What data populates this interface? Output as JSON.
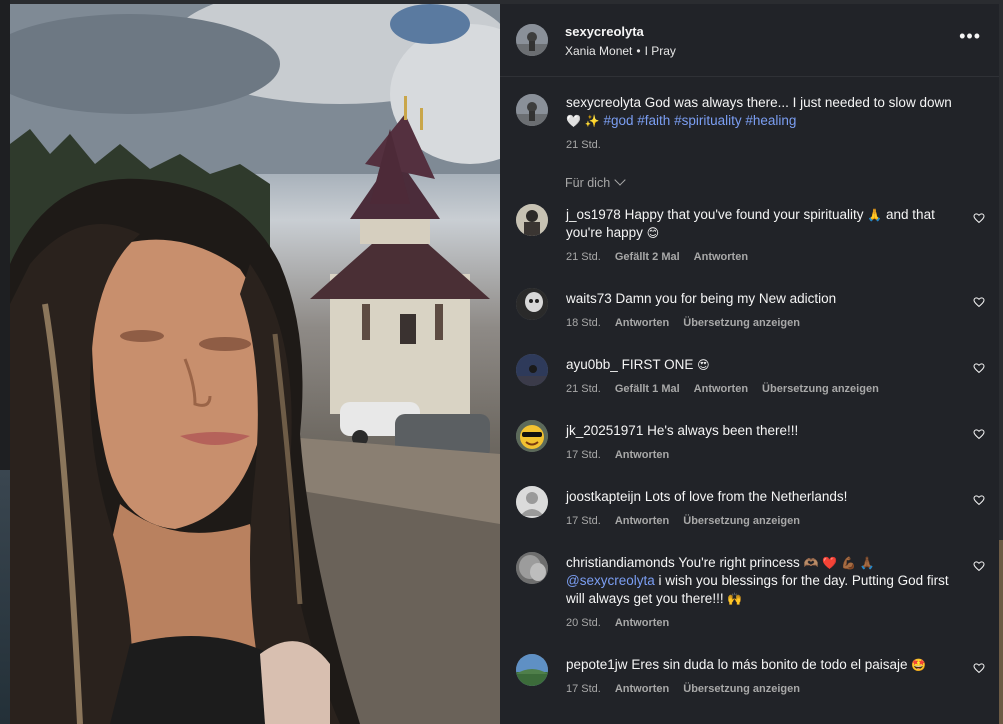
{
  "post": {
    "username": "sexycreolyta",
    "music_artist": "Xania Monet",
    "music_title": "I Pray"
  },
  "caption": {
    "username": "sexycreolyta",
    "text": "God was always there... I just needed to slow down",
    "emojis": "🤍 ✨",
    "hashtags": [
      "#god",
      "#faith",
      "#spirituality",
      "#healing"
    ],
    "time": "21 Std."
  },
  "for_you_label": "Für dich",
  "labels": {
    "reply": "Antworten",
    "translate": "Übersetzung anzeigen"
  },
  "comments": [
    {
      "username": "j_os1978",
      "text_before": "Happy that you've found your spirituality",
      "emoji_mid": "🙏",
      "text_after": "and that you're happy",
      "emoji_end": "😊",
      "time": "21 Std.",
      "likes": "Gefällt 2 Mal"
    },
    {
      "username": "waits73",
      "text": "Damn you for being my New adiction",
      "time": "18 Std."
    },
    {
      "username": "ayu0bb_",
      "text": "FIRST ONE",
      "emoji_end": "😍",
      "time": "21 Std.",
      "likes": "Gefällt 1 Mal"
    },
    {
      "username": "jk_20251971",
      "text": "He's always been there!!!",
      "time": "17 Std."
    },
    {
      "username": "joostkapteijn",
      "text": "Lots of love from the Netherlands!",
      "time": "17 Std."
    },
    {
      "username": "christiandiamonds",
      "text_before": "You're right princess",
      "emoji_mid": "🫶🏽 ❤️ 💪🏾 🙏🏾",
      "mention": "@sexycreolyta",
      "text_after": "i wish you blessings for the day. Putting God first will always get you there!!!",
      "emoji_end": "🙌",
      "time": "20 Std."
    },
    {
      "username": "pepote1jw",
      "text": "Eres sin duda lo más bonito de todo el paisaje",
      "emoji_end": "🤩",
      "time": "17 Std."
    }
  ]
}
